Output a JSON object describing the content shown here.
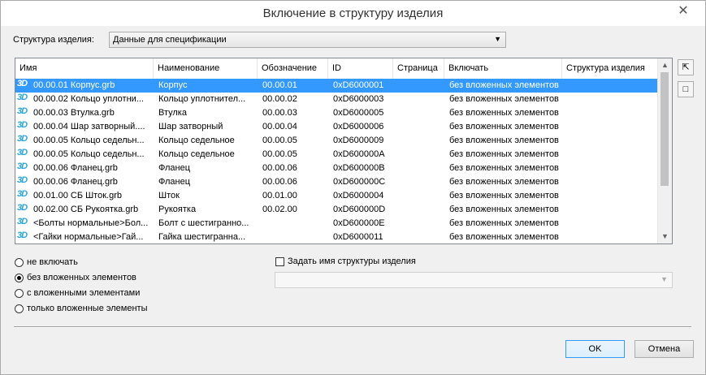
{
  "window": {
    "title": "Включение в структуру изделия",
    "close": "✕"
  },
  "structure": {
    "label": "Структура изделия:",
    "value": "Данные для спецификации"
  },
  "table": {
    "headers": [
      "Имя",
      "Наименование",
      "Обозначение",
      "ID",
      "Страница",
      "Включать",
      "Структура изделия"
    ],
    "rows": [
      {
        "icon": "3D",
        "name": "00.00.01 Корпус.grb",
        "title": "Корпус",
        "designation": "00.00.01",
        "id": "0xD6000001",
        "page": "",
        "include": "без вложенных элементов",
        "structure": ""
      },
      {
        "icon": "3D",
        "name": "00.00.02 Кольцо уплотни...",
        "title": "Кольцо уплотнител...",
        "designation": "00.00.02",
        "id": "0xD6000003",
        "page": "",
        "include": "без вложенных элементов",
        "structure": ""
      },
      {
        "icon": "3D",
        "name": "00.00.03 Втулка.grb",
        "title": "Втулка",
        "designation": "00.00.03",
        "id": "0xD6000005",
        "page": "",
        "include": "без вложенных элементов",
        "structure": ""
      },
      {
        "icon": "3D",
        "name": "00.00.04 Шар затворный....",
        "title": "Шар затворный",
        "designation": "00.00.04",
        "id": "0xD6000006",
        "page": "",
        "include": "без вложенных элементов",
        "structure": ""
      },
      {
        "icon": "3D",
        "name": "00.00.05 Кольцо седельн...",
        "title": "Кольцо седельное",
        "designation": "00.00.05",
        "id": "0xD6000009",
        "page": "",
        "include": "без вложенных элементов",
        "structure": ""
      },
      {
        "icon": "3D",
        "name": "00.00.05 Кольцо седельн...",
        "title": "Кольцо седельное",
        "designation": "00.00.05",
        "id": "0xD600000A",
        "page": "",
        "include": "без вложенных элементов",
        "structure": ""
      },
      {
        "icon": "3D",
        "name": "00.00.06 Фланец.grb",
        "title": "Фланец",
        "designation": "00.00.06",
        "id": "0xD600000B",
        "page": "",
        "include": "без вложенных элементов",
        "structure": ""
      },
      {
        "icon": "3D",
        "name": "00.00.06 Фланец.grb",
        "title": "Фланец",
        "designation": "00.00.06",
        "id": "0xD600000C",
        "page": "",
        "include": "без вложенных элементов",
        "structure": ""
      },
      {
        "icon": "3D",
        "name": "00.01.00 СБ Шток.grb",
        "title": "Шток",
        "designation": "00.01.00",
        "id": "0xD6000004",
        "page": "",
        "include": "без вложенных элементов",
        "structure": ""
      },
      {
        "icon": "3D",
        "name": "00.02.00 СБ Рукоятка.grb",
        "title": "Рукоятка",
        "designation": "00.02.00",
        "id": "0xD600000D",
        "page": "",
        "include": "без вложенных элементов",
        "structure": ""
      },
      {
        "icon": "3D",
        "name": "<Болты нормальные>Бол...",
        "title": "Болт с шестигранно...",
        "designation": "",
        "id": "0xD600000E",
        "page": "",
        "include": "без вложенных элементов",
        "structure": ""
      },
      {
        "icon": "3D",
        "name": "<Гайки нормальные>Гай...",
        "title": "Гайка шестигранна...",
        "designation": "",
        "id": "0xD6000011",
        "page": "",
        "include": "без вложенных элементов",
        "structure": ""
      }
    ]
  },
  "side": {
    "select_all_icon": "select-cursor-icon",
    "frame_icon": "square-icon"
  },
  "options": {
    "radios": [
      {
        "label": "не включать",
        "checked": false
      },
      {
        "label": "без вложенных элементов",
        "checked": true
      },
      {
        "label": "с вложенными элементами",
        "checked": false
      },
      {
        "label": "только вложенные элементы",
        "checked": false
      }
    ],
    "set_name_label": "Задать имя структуры изделия",
    "set_name_checked": false
  },
  "buttons": {
    "ok": "OK",
    "cancel": "Отмена"
  },
  "colors": {
    "selection": "#3399ff",
    "icon3d": "#2aa6d9"
  }
}
